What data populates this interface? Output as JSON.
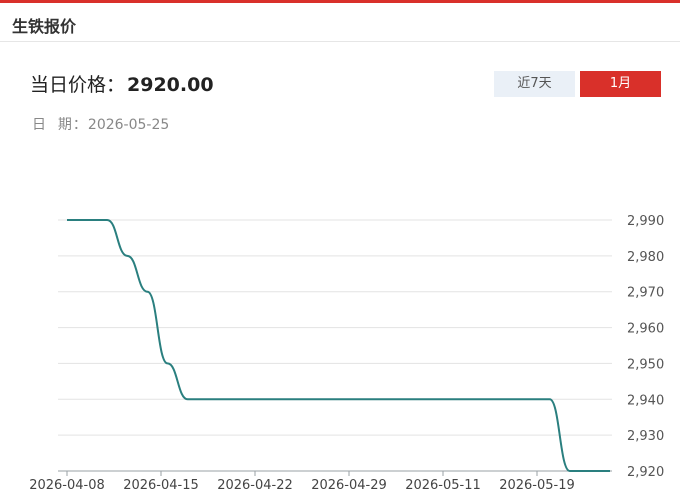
{
  "header": {
    "title": "生铁报价"
  },
  "price": {
    "label": "当日价格：",
    "value": "2920.00"
  },
  "date": {
    "label": "日  期：",
    "value": "2026-05-25"
  },
  "range_tabs": [
    {
      "label": "近7天",
      "active": false
    },
    {
      "label": "1月",
      "active": true
    }
  ],
  "colors": {
    "accent": "#d9302a",
    "line": "#2a7f7f",
    "tab_inactive": "#eaf0f7"
  },
  "chart_data": {
    "type": "line",
    "title": "",
    "xlabel": "",
    "ylabel": "",
    "x_ticks": [
      "2026-04-08",
      "2026-04-15",
      "2026-04-22",
      "2026-04-29",
      "2026-05-11",
      "2026-05-19"
    ],
    "y_ticks": [
      "2,990",
      "2,980",
      "2,970",
      "2,960",
      "2,950",
      "2,940",
      "2,930",
      "2,920"
    ],
    "ylim": [
      2920,
      2990
    ],
    "grid": true,
    "series": [
      {
        "values": [
          2990,
          2990,
          2990,
          2980,
          2970,
          2950,
          2940,
          2940,
          2940,
          2940,
          2940,
          2940,
          2940,
          2940,
          2940,
          2940,
          2940,
          2940,
          2940,
          2940,
          2940,
          2940,
          2940,
          2940,
          2940,
          2920,
          2920,
          2920
        ]
      }
    ]
  }
}
